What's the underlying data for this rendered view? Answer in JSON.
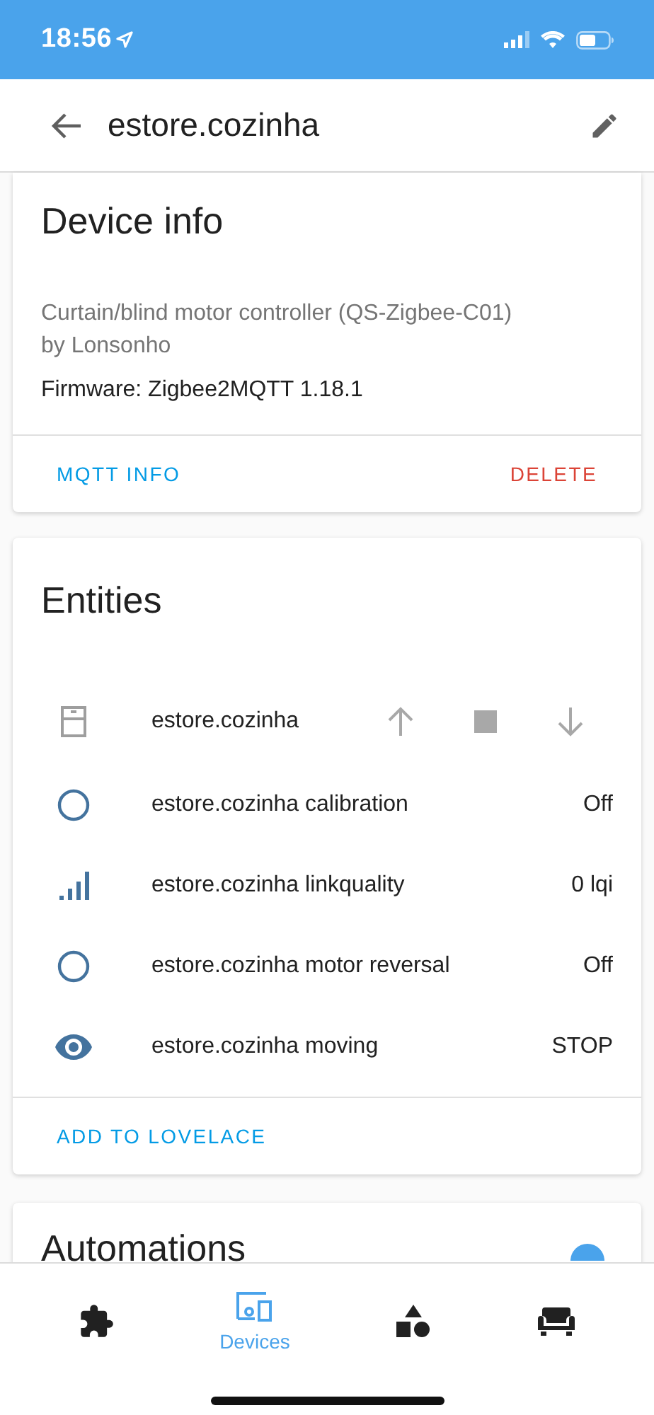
{
  "status_bar": {
    "time": "18:56"
  },
  "header": {
    "title": "estore.cozinha"
  },
  "device_info": {
    "title": "Device info",
    "model": "Curtain/blind motor controller (QS-Zigbee-C01)",
    "manufacturer": "by Lonsonho",
    "firmware": "Firmware: Zigbee2MQTT 1.18.1",
    "actions": [
      {
        "label": "MQTT INFO",
        "kind": "primary"
      },
      {
        "label": "DELETE",
        "kind": "danger"
      }
    ]
  },
  "entities": {
    "title": "Entities",
    "rows": [
      {
        "kind": "cover",
        "name": "estore.cozinha",
        "controls": [
          {
            "kind": "up"
          },
          {
            "kind": "stop"
          },
          {
            "kind": "down"
          }
        ]
      },
      {
        "kind": "toggle",
        "name": "estore.cozinha calibration",
        "value": "Off"
      },
      {
        "kind": "signal",
        "name": "estore.cozinha linkquality",
        "value": "0 lqi"
      },
      {
        "kind": "toggle",
        "name": "estore.cozinha motor reversal",
        "value": "Off"
      },
      {
        "kind": "eye",
        "name": "estore.cozinha moving",
        "value": "STOP"
      }
    ],
    "action": "ADD TO LOVELACE"
  },
  "automations": {
    "title": "Automations"
  },
  "bottom_nav": [
    {
      "kind": "integrations",
      "selected": false
    },
    {
      "kind": "devices",
      "selected": true,
      "label": "Devices"
    },
    {
      "kind": "entities",
      "selected": false
    },
    {
      "kind": "areas",
      "selected": false
    }
  ]
}
